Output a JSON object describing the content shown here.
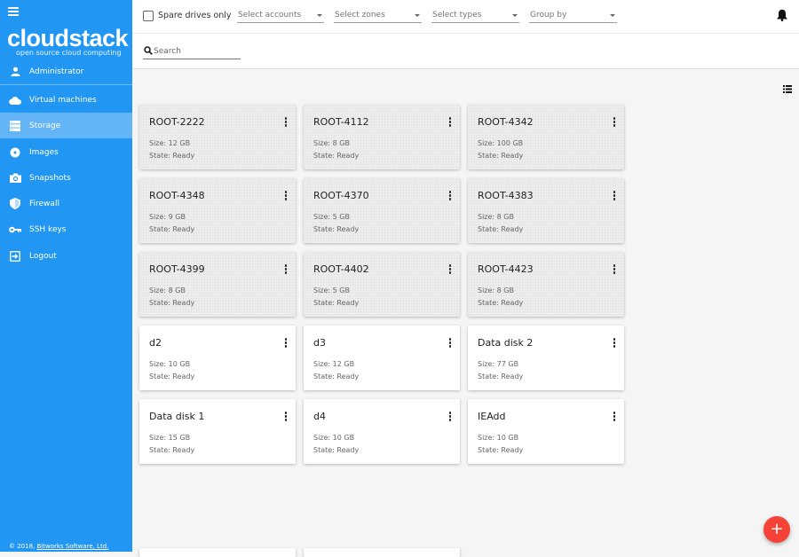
{
  "sidebar": {
    "logo": "cloudstack",
    "logo_sub": "open source cloud computing",
    "user": "Administrator",
    "items": [
      {
        "label": "Virtual machines",
        "icon": "cloud-icon"
      },
      {
        "label": "Storage",
        "icon": "storage-icon"
      },
      {
        "label": "Images",
        "icon": "disc-icon"
      },
      {
        "label": "Snapshots",
        "icon": "camera-icon"
      },
      {
        "label": "Firewall",
        "icon": "shield-icon"
      },
      {
        "label": "SSH keys",
        "icon": "key-icon"
      },
      {
        "label": "Logout",
        "icon": "logout-icon"
      }
    ],
    "footer_prefix": "© 2018,",
    "footer_link": "Bitworks Software, Ltd."
  },
  "filters": {
    "spare_drives_label": "Spare drives only",
    "accounts_placeholder": "Select accounts",
    "zones_placeholder": "Select zones",
    "types_placeholder": "Select types",
    "group_by_placeholder": "Group by"
  },
  "search": {
    "placeholder": "Search"
  },
  "colors": {
    "sidebar": "#2196f3",
    "active_item": "#64b5f6",
    "fab": "#f44336"
  },
  "volumes": [
    {
      "name": "ROOT-2222",
      "size": "Size: 12 GB",
      "state": "State: Ready"
    },
    {
      "name": "ROOT-4112",
      "size": "Size: 8 GB",
      "state": "State: Ready"
    },
    {
      "name": "ROOT-4342",
      "size": "Size: 100 GB",
      "state": "State: Ready"
    },
    {
      "name": "ROOT-4348",
      "size": "Size: 9 GB",
      "state": "State: Ready"
    },
    {
      "name": "ROOT-4370",
      "size": "Size: 5 GB",
      "state": "State: Ready"
    },
    {
      "name": "ROOT-4383",
      "size": "Size: 8 GB",
      "state": "State: Ready"
    },
    {
      "name": "ROOT-4399",
      "size": "Size: 8 GB",
      "state": "State: Ready"
    },
    {
      "name": "ROOT-4402",
      "size": "Size: 5 GB",
      "state": "State: Ready"
    },
    {
      "name": "ROOT-4423",
      "size": "Size: 8 GB",
      "state": "State: Ready"
    },
    {
      "name": "d2",
      "size": "Size: 10 GB",
      "state": "State: Ready"
    },
    {
      "name": "d3",
      "size": "Size: 12 GB",
      "state": "State: Ready"
    },
    {
      "name": "Data disk 2",
      "size": "Size: 77 GB",
      "state": "State: Ready"
    },
    {
      "name": "Data disk 1",
      "size": "Size: 15 GB",
      "state": "State: Ready"
    },
    {
      "name": "d4",
      "size": "Size: 10 GB",
      "state": "State: Ready"
    },
    {
      "name": "IEAdd",
      "size": "Size: 10 GB",
      "state": "State: Ready"
    }
  ],
  "fab_label": "+"
}
